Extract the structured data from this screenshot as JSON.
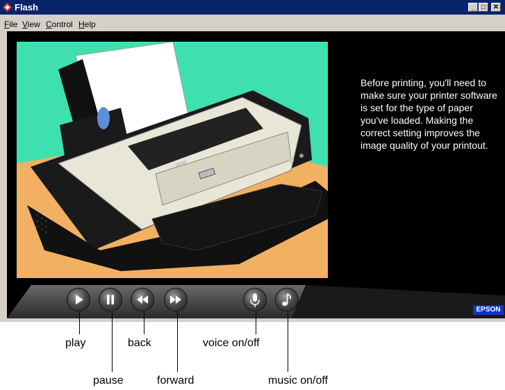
{
  "window": {
    "title": "Flash"
  },
  "menu": [
    {
      "label": "File",
      "accel": "F",
      "rest": "ile"
    },
    {
      "label": "View",
      "accel": "V",
      "rest": "iew"
    },
    {
      "label": "Control",
      "accel": "C",
      "rest": "ontrol"
    },
    {
      "label": "Help",
      "accel": "H",
      "rest": "elp"
    }
  ],
  "caption": "Before printing, you'll need to make sure your printer software is set for the type of paper you've loaded. Making the correct setting improves the image quality of your printout.",
  "brand": "EPSON",
  "controls": {
    "play": "play-icon",
    "pause": "pause-icon",
    "back": "rewind-icon",
    "forward": "fast-forward-icon",
    "voice": "microphone-icon",
    "music": "music-note-icon"
  },
  "callouts": {
    "play": "play",
    "pause": "pause",
    "back": "back",
    "forward": "forward",
    "voice": "voice on/off",
    "music": "music on/off"
  },
  "colors": {
    "illustration_background": "#3fe0b0",
    "table": "#f2b062",
    "printer_body": "#e8e6d6"
  }
}
